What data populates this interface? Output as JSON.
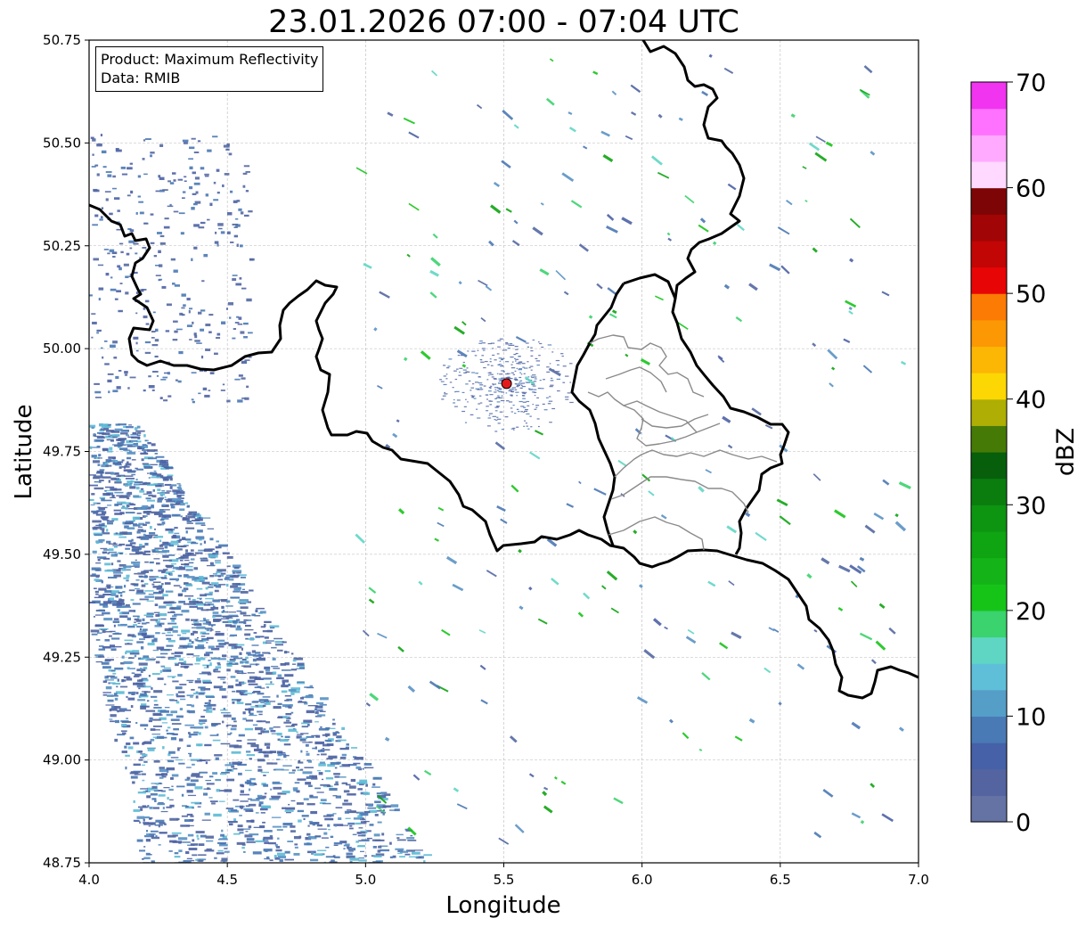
{
  "title": "23.01.2026 07:00 - 07:04 UTC",
  "info_box": {
    "product_line": "Product: Maximum Reflectivity",
    "data_line": "Data: RMIB"
  },
  "axes": {
    "xlabel": "Longitude",
    "ylabel": "Latitude",
    "xlim": [
      4.0,
      7.0
    ],
    "ylim": [
      48.75,
      50.75
    ],
    "xticks": [
      "4.0",
      "4.5",
      "5.0",
      "5.5",
      "6.0",
      "6.5",
      "7.0"
    ],
    "yticks": [
      "48.75",
      "49.00",
      "49.25",
      "49.50",
      "49.75",
      "50.00",
      "50.25",
      "50.50",
      "50.75"
    ],
    "grid": true
  },
  "colorbar": {
    "label": "dBZ",
    "range": [
      0,
      70
    ],
    "tick_labels": [
      "0",
      "10",
      "20",
      "30",
      "40",
      "50",
      "60",
      "70"
    ],
    "colors": [
      "#6473a4",
      "#5464a0",
      "#4661a8",
      "#4a7ab5",
      "#559ec8",
      "#5fbfd9",
      "#5fd6c4",
      "#3ad36d",
      "#16c418",
      "#14b418",
      "#0ea412",
      "#0d9411",
      "#0a7d0e",
      "#075f0b",
      "#467a06",
      "#aeae04",
      "#fcd704",
      "#fcb604",
      "#fc9804",
      "#fb7b04",
      "#e80505",
      "#c20505",
      "#a20505",
      "#7d0505",
      "#ffd9ff",
      "#ffaaff",
      "#ff72ff",
      "#f034f0"
    ]
  },
  "radar_site": {
    "lon": 5.51,
    "lat": 49.915,
    "color": "#e31a1c"
  },
  "colors": {
    "border": "#000000",
    "admin_border": "#8a8a8a",
    "grid": "#b9b9b9"
  }
}
